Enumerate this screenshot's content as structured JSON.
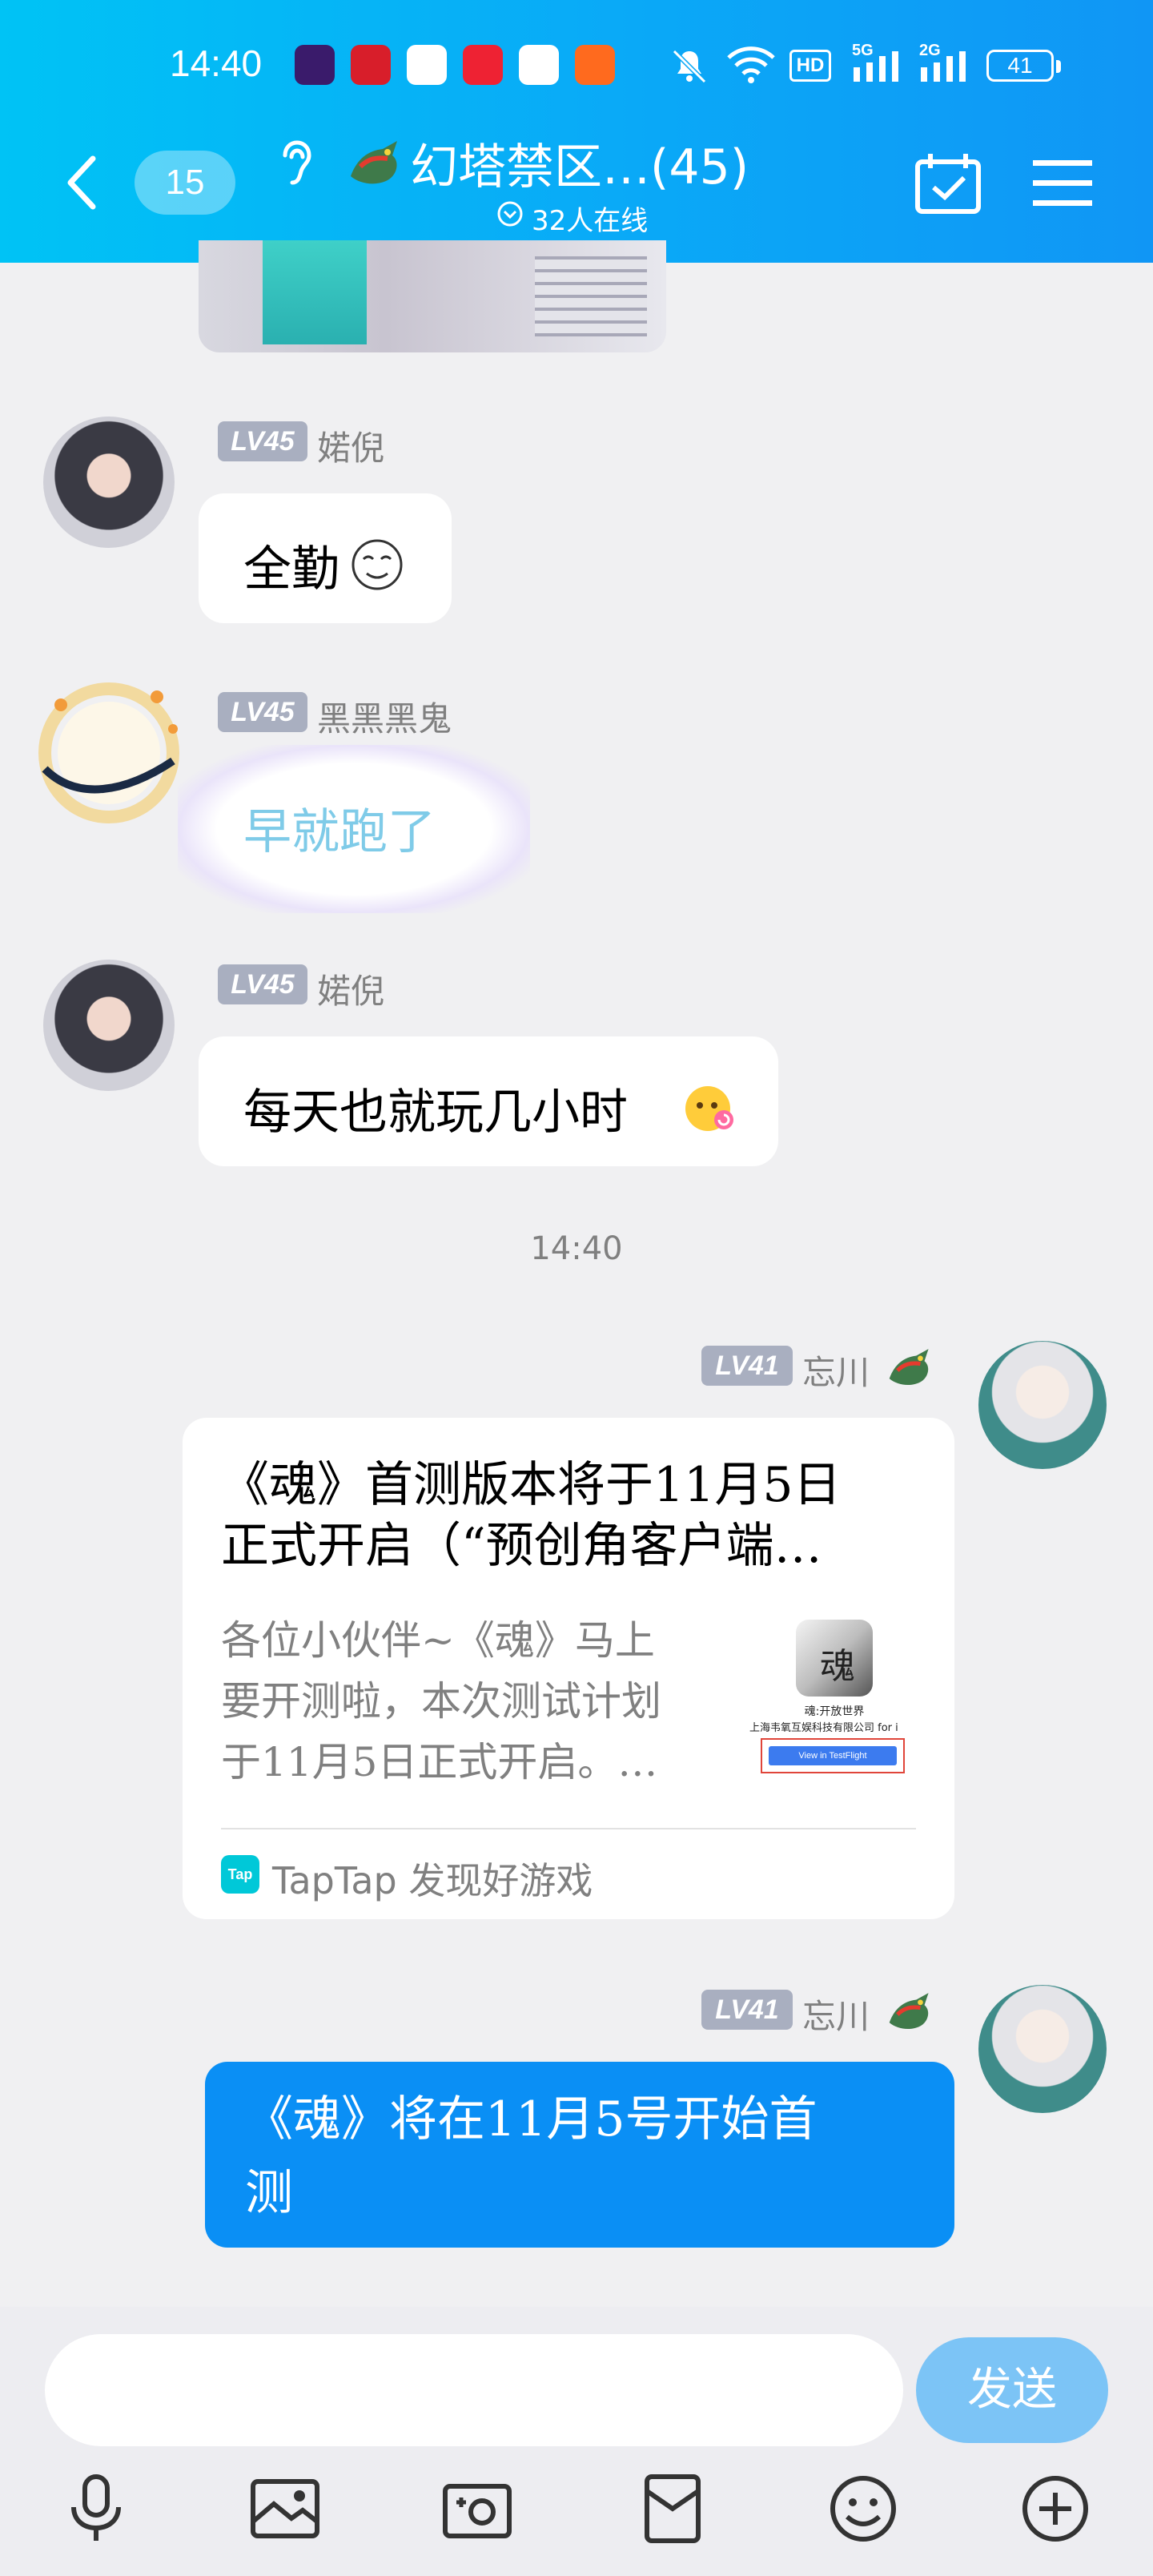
{
  "status_bar": {
    "time": "14:40",
    "network_5g": "5G",
    "network_2g": "2G",
    "hd": "HD",
    "battery": "41"
  },
  "header": {
    "unread_count": "15",
    "group_title": "幻塔禁区…(45)",
    "online": "32人在线"
  },
  "messages": [
    {
      "level": "LV45",
      "nickname": "婼倪",
      "text": "全勤"
    },
    {
      "level": "LV45",
      "nickname": "黑黑黑鬼",
      "text": "早就跑了"
    },
    {
      "level": "LV45",
      "nickname": "婼倪",
      "text": "每天也就玩几小时"
    },
    {
      "level": "LV41",
      "nickname": "忘川"
    },
    {
      "level": "LV41",
      "nickname": "忘川",
      "text_line1": "《魂》将在11月5号开始首",
      "text_line2": "测"
    }
  ],
  "timestamp": "14:40",
  "share_card": {
    "title_line1": "《魂》首测版本将于11月5日",
    "title_line2": "正式开启（“预创角客户端…",
    "desc_line1": "各位小伙伴~《魂》马上",
    "desc_line2": "要开测啦，本次测试计划",
    "desc_line3": "于11月5日正式开启。…",
    "source_logo": "Tap",
    "source": "TapTap 发现好游戏",
    "thumb_caption1": "魂:开放世界",
    "thumb_caption2": "上海韦氧互娱科技有限公司 for i",
    "thumb_button": "View in TestFlight"
  },
  "input": {
    "send_label": "发送"
  },
  "toolbar": [
    "microphone-icon",
    "image-icon",
    "camera-icon",
    "red-packet-icon",
    "emoji-icon",
    "plus-icon"
  ],
  "colors": {
    "header": "#0aa9f7",
    "self_bubble": "#0a8ff5",
    "level_badge": "#a9afc0",
    "send_button": "#7cc4f6"
  }
}
